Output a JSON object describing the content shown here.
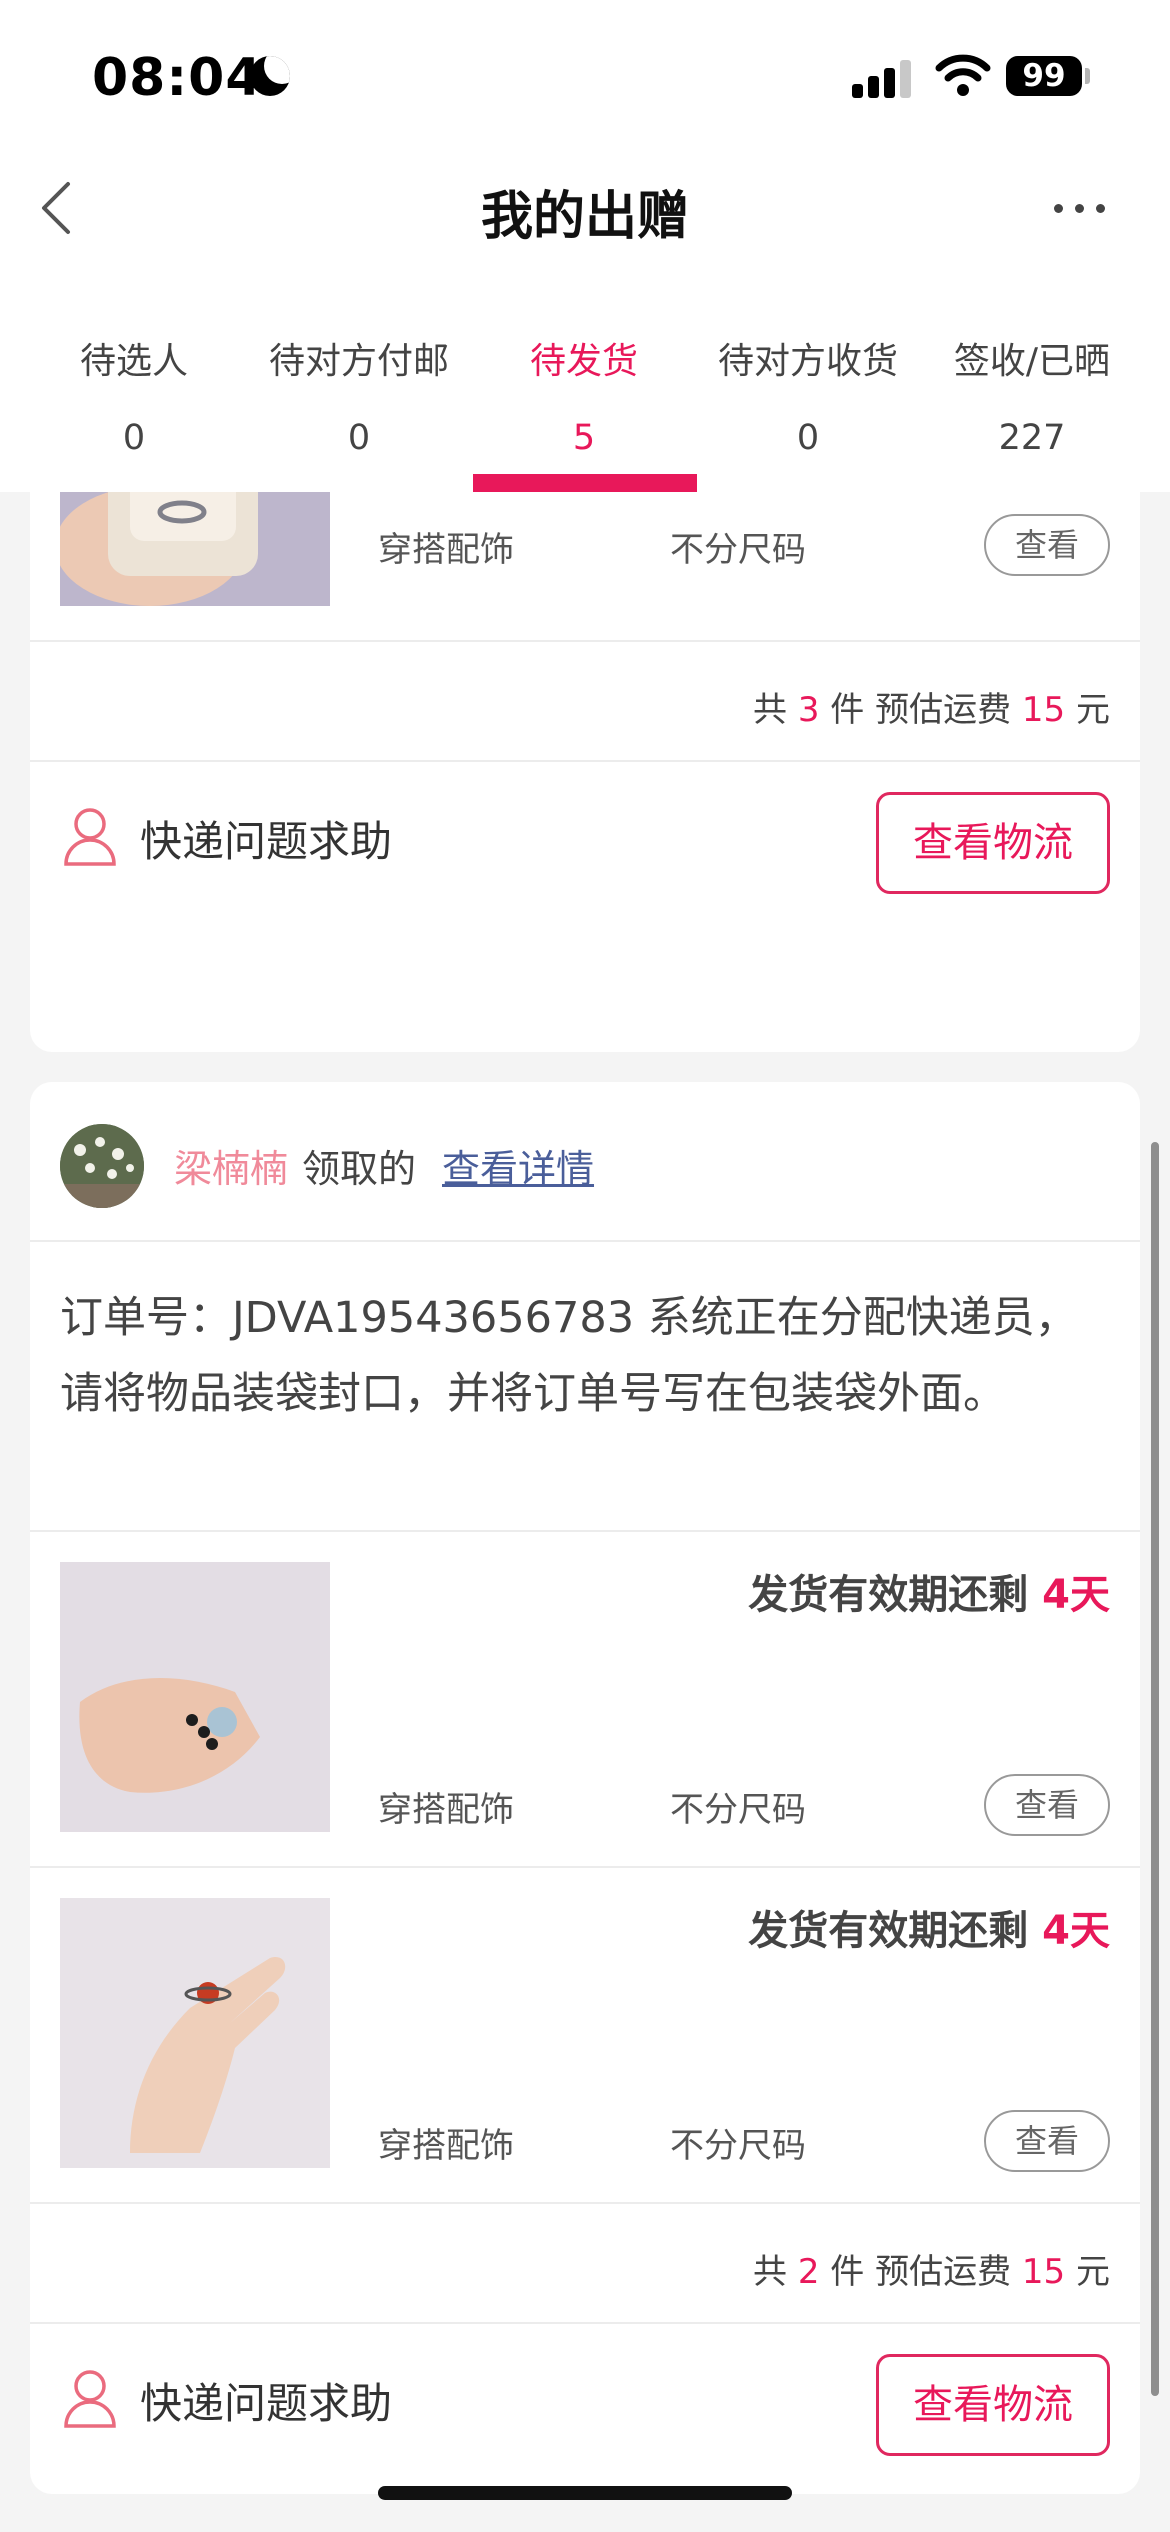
{
  "status_bar": {
    "time": "08:04",
    "battery": "99"
  },
  "nav": {
    "title": "我的出赠"
  },
  "tabs": [
    {
      "label": "待选人",
      "count": "0"
    },
    {
      "label": "待对方付邮",
      "count": "0"
    },
    {
      "label": "待发货",
      "count": "5",
      "active": true
    },
    {
      "label": "待对方收货",
      "count": "0"
    },
    {
      "label": "签收/已晒",
      "count": "227"
    }
  ],
  "card1": {
    "item": {
      "category": "穿搭配饰",
      "size": "不分尺码",
      "view_label": "查看"
    },
    "summary": {
      "prefix": "共",
      "count": "3",
      "unit": "件 预估运费",
      "fee": "15",
      "currency": "元"
    },
    "help_label": "快递问题求助",
    "logistics_label": "查看物流"
  },
  "card2": {
    "receiver_name": "梁楠楠",
    "receiver_suffix": "领取的",
    "detail_link": "查看详情",
    "order_note": "订单号：JDVA19543656783 系统正在分配快递员，请将物品装袋封口，并将订单号写在包装袋外面。",
    "items": [
      {
        "deadline_text": "发货有效期还剩",
        "deadline_days": "4天",
        "category": "穿搭配饰",
        "size": "不分尺码",
        "view_label": "查看"
      },
      {
        "deadline_text": "发货有效期还剩",
        "deadline_days": "4天",
        "category": "穿搭配饰",
        "size": "不分尺码",
        "view_label": "查看"
      }
    ],
    "summary": {
      "prefix": "共",
      "count": "2",
      "unit": "件 预估运费",
      "fee": "15",
      "currency": "元"
    },
    "help_label": "快递问题求助",
    "logistics_label": "查看物流"
  },
  "colors": {
    "accent": "#e8185a",
    "link": "#4a5e9a",
    "receiver": "#f08a9a"
  }
}
